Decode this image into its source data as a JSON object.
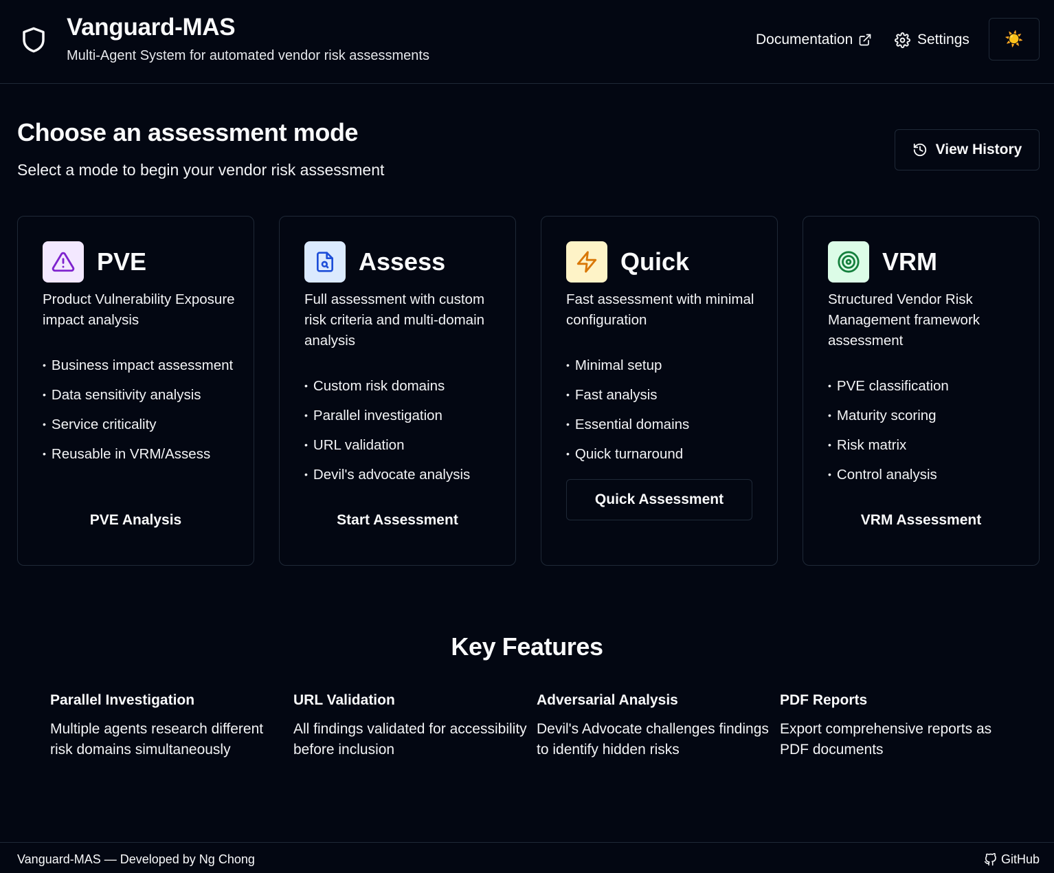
{
  "header": {
    "title": "Vanguard-MAS",
    "subtitle": "Multi-Agent System for automated vendor risk assessments",
    "documentation_label": "Documentation",
    "settings_label": "Settings",
    "theme_toggle_glyph": "☀️"
  },
  "main": {
    "title": "Choose an assessment mode",
    "subtitle": "Select a mode to begin your vendor risk assessment",
    "view_history_label": "View History"
  },
  "modes": [
    {
      "title": "PVE",
      "icon": "alert-triangle-icon",
      "icon_color": "#7e22ce",
      "icon_bg": "#f3e8ff",
      "description": "Product Vulnerability Exposure impact analysis",
      "features": [
        "Business impact assessment",
        "Data sensitivity analysis",
        "Service criticality",
        "Reusable in VRM/Assess"
      ],
      "action_label": "PVE Analysis"
    },
    {
      "title": "Assess",
      "icon": "file-search-icon",
      "icon_color": "#1d4ed8",
      "icon_bg": "#dbeafe",
      "description": "Full assessment with custom risk criteria and multi-domain analysis",
      "features": [
        "Custom risk domains",
        "Parallel investigation",
        "URL validation",
        "Devil's advocate analysis"
      ],
      "action_label": "Start Assessment"
    },
    {
      "title": "Quick",
      "icon": "lightning-bolt-icon",
      "icon_color": "#d97706",
      "icon_bg": "#fef3c7",
      "description": "Fast assessment with minimal configuration",
      "features": [
        "Minimal setup",
        "Fast analysis",
        "Essential domains",
        "Quick turnaround"
      ],
      "action_label": "Quick Assessment"
    },
    {
      "title": "VRM",
      "icon": "target-icon",
      "icon_color": "#15803d",
      "icon_bg": "#dcfce7",
      "description": "Structured Vendor Risk Management framework assessment",
      "features": [
        "PVE classification",
        "Maturity scoring",
        "Risk matrix",
        "Control analysis"
      ],
      "action_label": "VRM Assessment"
    }
  ],
  "key_features": {
    "title": "Key Features",
    "items": [
      {
        "name": "Parallel Investigation",
        "description": "Multiple agents research different risk domains simultaneously"
      },
      {
        "name": "URL Validation",
        "description": "All findings validated for accessibility before inclusion"
      },
      {
        "name": "Adversarial Analysis",
        "description": "Devil's Advocate challenges findings to identify hidden risks"
      },
      {
        "name": "PDF Reports",
        "description": "Export comprehensive reports as PDF documents"
      }
    ]
  },
  "footer": {
    "text": "Vanguard-MAS — Developed by Ng Chong",
    "github_label": "GitHub"
  }
}
